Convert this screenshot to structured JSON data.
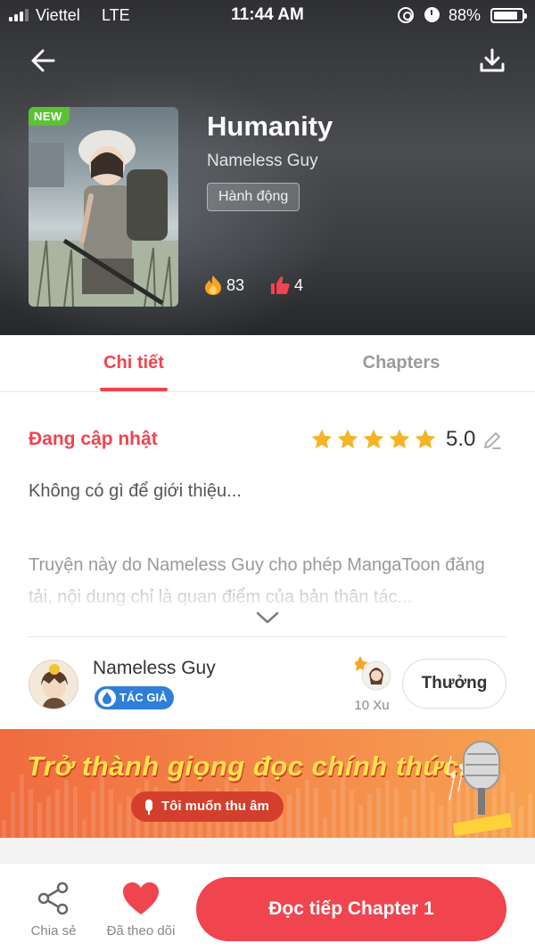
{
  "status_bar": {
    "carrier": "Viettel",
    "network": "LTE",
    "time": "11:44 AM",
    "battery": "88%"
  },
  "header": {
    "back_icon": "arrow-left-icon",
    "download_icon": "download-icon"
  },
  "book": {
    "badge": "NEW",
    "title": "Humanity",
    "author": "Nameless Guy",
    "genre": "Hành động",
    "fire_count": "83",
    "like_count": "4"
  },
  "tabs": [
    {
      "label": "Chi tiết",
      "active": true
    },
    {
      "label": "Chapters",
      "active": false
    }
  ],
  "detail": {
    "status": "Đang cập nhật",
    "rating": "5.0",
    "rating_stars": 5,
    "intro": "Không có gì để giới thiệu...",
    "notice": "Truyện này do Nameless Guy cho phép MangaToon đăng tải, nội dung chỉ là quan điểm của bản thân tác..."
  },
  "author_row": {
    "name": "Nameless Guy",
    "badge": "TÁC GIẢ",
    "coins": "10 Xu",
    "reward_button": "Thưởng"
  },
  "banner": {
    "title": "Trở thành giọng đọc chính thức!",
    "button": "Tôi muốn thu âm"
  },
  "bottom_bar": {
    "share_label": "Chia sẻ",
    "follow_label": "Đã theo dõi",
    "read_button": "Đọc tiếp Chapter 1"
  },
  "colors": {
    "accent": "#f0444f",
    "new_badge": "#5bc236",
    "star": "#f5b428",
    "author_badge": "#2f7fd8",
    "banner_start": "#f06b3f",
    "banner_end": "#f7a250"
  }
}
